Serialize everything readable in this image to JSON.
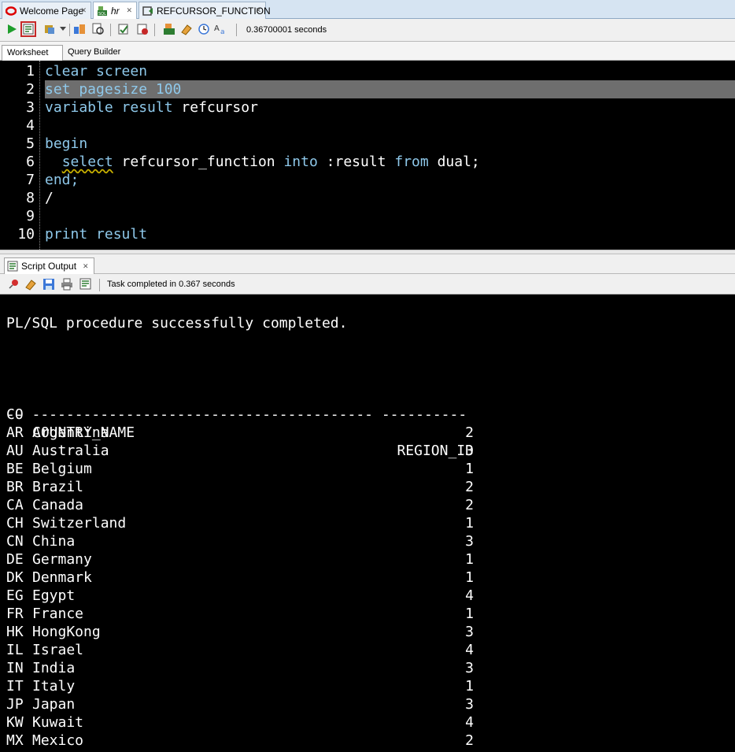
{
  "doc_tabs": [
    {
      "label": "Welcome Page",
      "icon": "oracle-icon"
    },
    {
      "label": "hr",
      "icon": "sql-worksheet-icon"
    },
    {
      "label": "REFCURSOR_FUNCTION",
      "icon": "function-icon"
    }
  ],
  "toolbar": {
    "elapsed": "0.36700001 seconds"
  },
  "subtabs": [
    "Worksheet",
    "Query Builder"
  ],
  "editor": {
    "line_numbers": [
      "1",
      "2",
      "3",
      "4",
      "5",
      "6",
      "7",
      "8",
      "9",
      "10"
    ],
    "highlighted_line": 2,
    "lines": [
      [
        {
          "t": "clear screen",
          "k": true
        }
      ],
      [
        {
          "t": "set pagesize 100",
          "k": true
        }
      ],
      [
        {
          "t": "variable result ",
          "k": true
        },
        {
          "t": "refcursor",
          "k": false
        }
      ],
      [],
      [
        {
          "t": "begin",
          "k": true
        }
      ],
      [
        {
          "t": "  ",
          "k": false
        },
        {
          "t": "select",
          "k": true,
          "squiggle": true
        },
        {
          "t": " refcursor_function ",
          "k": false
        },
        {
          "t": "into",
          "k": true
        },
        {
          "t": " :result ",
          "k": false
        },
        {
          "t": "from",
          "k": true
        },
        {
          "t": " dual;",
          "k": false
        }
      ],
      [
        {
          "t": "end;",
          "k": true
        }
      ],
      [
        {
          "t": "/",
          "k": false
        }
      ],
      [],
      [
        {
          "t": "print result",
          "k": true
        }
      ]
    ]
  },
  "output_panel": {
    "tab_label": "Script Output",
    "status": "Task completed in 0.367 seconds",
    "message": "PL/SQL procedure successfully completed.",
    "headers": {
      "code": "CO",
      "name": "COUNTRY_NAME",
      "region": "REGION_ID"
    },
    "separator": "-- ---------------------------------------- ----------",
    "rows": [
      {
        "code": "AR",
        "name": "Argentina",
        "region": "2"
      },
      {
        "code": "AU",
        "name": "Australia",
        "region": "3"
      },
      {
        "code": "BE",
        "name": "Belgium",
        "region": "1"
      },
      {
        "code": "BR",
        "name": "Brazil",
        "region": "2"
      },
      {
        "code": "CA",
        "name": "Canada",
        "region": "2"
      },
      {
        "code": "CH",
        "name": "Switzerland",
        "region": "1"
      },
      {
        "code": "CN",
        "name": "China",
        "region": "3"
      },
      {
        "code": "DE",
        "name": "Germany",
        "region": "1"
      },
      {
        "code": "DK",
        "name": "Denmark",
        "region": "1"
      },
      {
        "code": "EG",
        "name": "Egypt",
        "region": "4"
      },
      {
        "code": "FR",
        "name": "France",
        "region": "1"
      },
      {
        "code": "HK",
        "name": "HongKong",
        "region": "3"
      },
      {
        "code": "IL",
        "name": "Israel",
        "region": "4"
      },
      {
        "code": "IN",
        "name": "India",
        "region": "3"
      },
      {
        "code": "IT",
        "name": "Italy",
        "region": "1"
      },
      {
        "code": "JP",
        "name": "Japan",
        "region": "3"
      },
      {
        "code": "KW",
        "name": "Kuwait",
        "region": "4"
      },
      {
        "code": "MX",
        "name": "Mexico",
        "region": "2"
      }
    ]
  },
  "colors": {
    "keyword": "#8ec8ea",
    "editor_bg": "#000000",
    "highlight_bg": "#6e6e6e"
  }
}
